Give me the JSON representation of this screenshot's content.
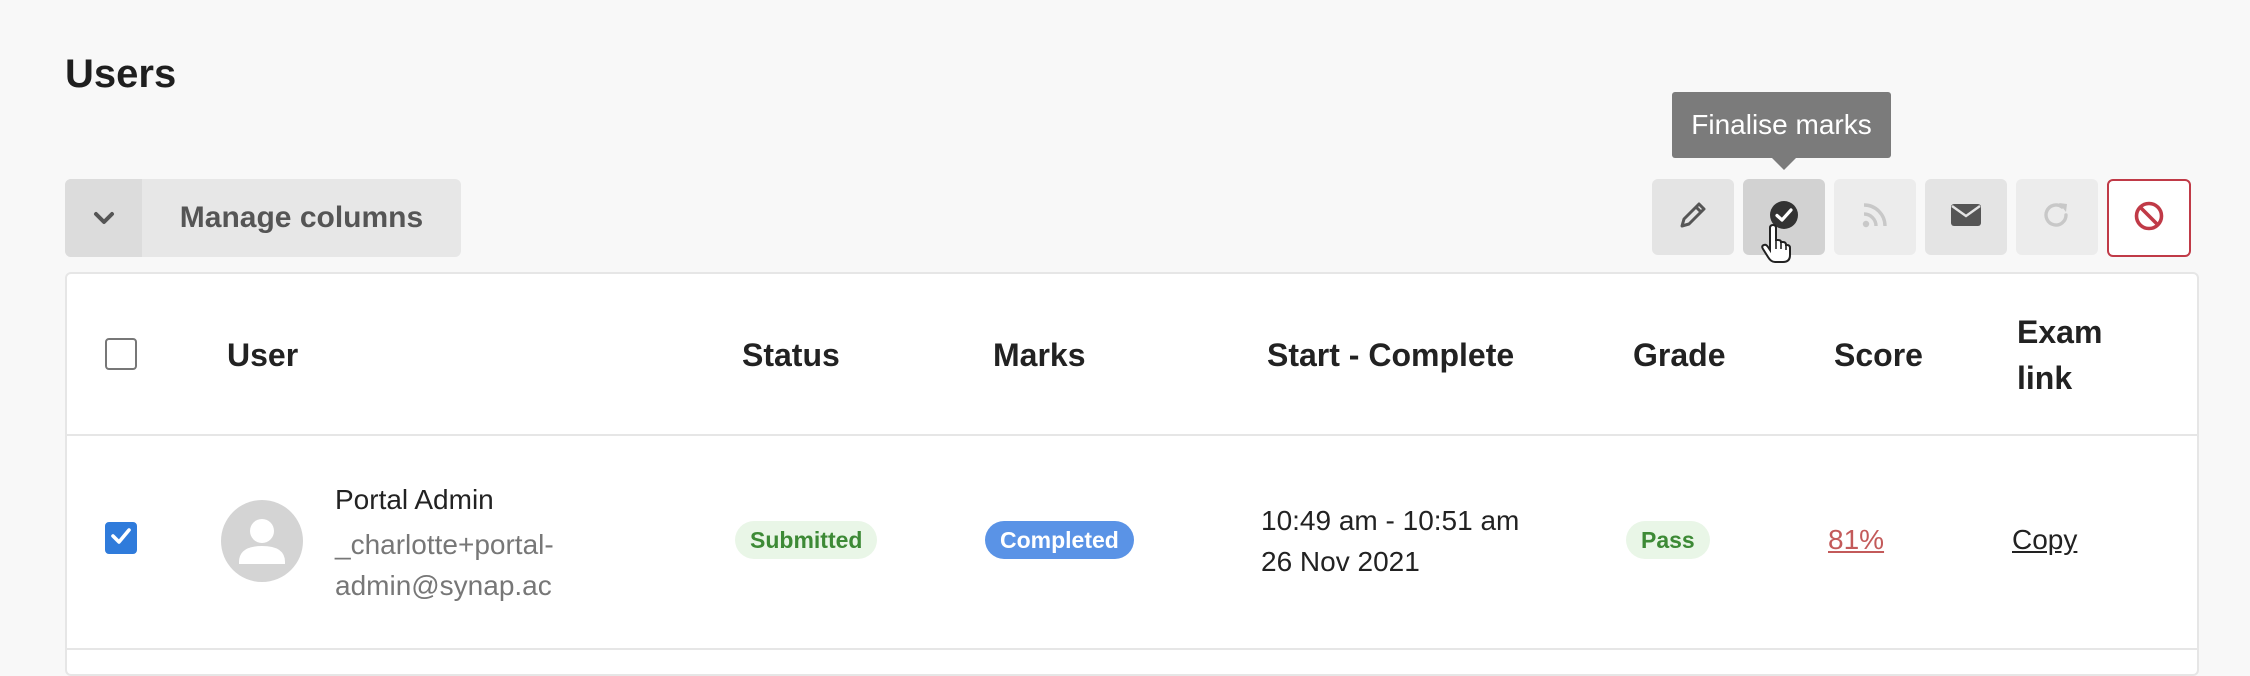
{
  "page": {
    "title": "Users"
  },
  "controls": {
    "manage_columns_label": "Manage columns"
  },
  "toolbar": {
    "tooltip": "Finalise marks",
    "buttons": [
      {
        "name": "edit",
        "icon": "pencil-icon",
        "state": "enabled"
      },
      {
        "name": "finalise-marks",
        "icon": "check-circle-icon",
        "state": "hovered"
      },
      {
        "name": "rss",
        "icon": "rss-icon",
        "state": "disabled"
      },
      {
        "name": "email",
        "icon": "envelope-icon",
        "state": "enabled"
      },
      {
        "name": "reload",
        "icon": "redo-icon",
        "state": "disabled"
      },
      {
        "name": "block",
        "icon": "ban-icon",
        "state": "danger"
      }
    ]
  },
  "table": {
    "headers": {
      "user": "User",
      "status": "Status",
      "marks": "Marks",
      "start_complete": "Start - Complete",
      "grade": "Grade",
      "score": "Score",
      "exam_link_line1": "Exam",
      "exam_link_line2": "link"
    },
    "rows": [
      {
        "checked": true,
        "name": "Portal Admin",
        "email_line1": "_charlotte+portal-",
        "email_line2": "admin@synap.ac",
        "status": "Submitted",
        "marks": "Completed",
        "time_range": "10:49 am - 10:51 am",
        "date": "26 Nov 2021",
        "grade": "Pass",
        "score": "81%",
        "exam_link": "Copy"
      }
    ]
  },
  "colors": {
    "accent": "#2f7bdb",
    "status_green_bg": "#e9f6e7",
    "status_green_text": "#3d8a36",
    "completed_bg": "#5a93e6",
    "score_red": "#c35a5a",
    "danger": "#c03a47"
  }
}
